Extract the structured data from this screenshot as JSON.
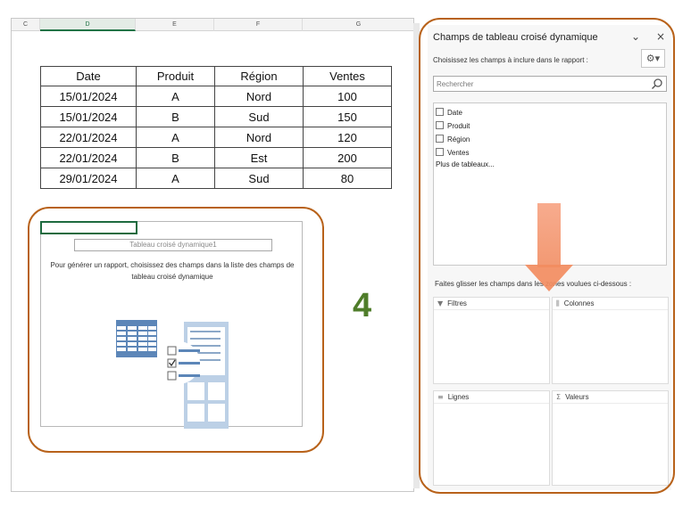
{
  "sheet": {
    "columns": [
      "C",
      "D",
      "E",
      "F",
      "G"
    ],
    "active_column": "D",
    "table": {
      "headers": [
        "Date",
        "Produit",
        "Région",
        "Ventes"
      ],
      "rows": [
        [
          "15/01/2024",
          "A",
          "Nord",
          "100"
        ],
        [
          "15/01/2024",
          "B",
          "Sud",
          "150"
        ],
        [
          "22/01/2024",
          "A",
          "Nord",
          "120"
        ],
        [
          "22/01/2024",
          "B",
          "Est",
          "200"
        ],
        [
          "29/01/2024",
          "A",
          "Sud",
          "80"
        ]
      ]
    },
    "pivot": {
      "title": "Tableau croisé dynamique1",
      "message": "Pour générer un rapport, choisissez des champs dans la liste des champs de tableau croisé dynamique"
    }
  },
  "annotation": {
    "step_number": "4"
  },
  "pane": {
    "title": "Champs de tableau croisé dynamique",
    "subtitle": "Choisissez les champs à inclure dans le rapport :",
    "search_placeholder": "Rechercher",
    "fields": [
      "Date",
      "Produit",
      "Région",
      "Ventes"
    ],
    "more_tables": "Plus de tableaux...",
    "drag_instruction": "Faites glisser les champs dans les zones voulues ci-dessous :",
    "areas": {
      "filters": "Filtres",
      "columns": "Colonnes",
      "rows": "Lignes",
      "values": "Valeurs"
    }
  },
  "colors": {
    "highlight_outline": "#b8621a",
    "arrow": "#f28c5f",
    "step_number": "#4f7d2a",
    "active_cell": "#1e6b3f"
  }
}
